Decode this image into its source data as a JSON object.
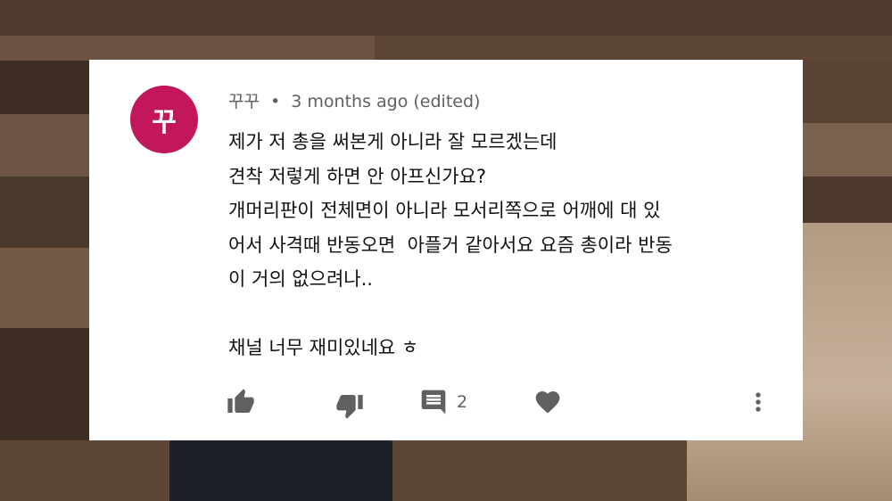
{
  "comment": {
    "avatar_initial": "꾸",
    "author": "꾸꾸",
    "separator": "•",
    "timestamp": "3 months ago (edited)",
    "lines": [
      "제가 저 총을 써본게 아니라 잘 모르겠는데",
      "견착 저렇게 하면 안 아프신가요?",
      "개머리판이 전체면이 아니라 모서리쪽으로 어깨에 대 있",
      "어서 사격때 반동오면  아플거 같아서요 요즘 총이라 반동",
      "이 거의 없으려나..",
      "",
      "채널 너무 재미있네요 ㅎ"
    ],
    "reply_count": "2"
  },
  "colors": {
    "avatar": "#c2185b",
    "icon": "#606060",
    "meta_text": "#606060"
  },
  "icons": [
    "thumbs-up-icon",
    "thumbs-down-icon",
    "comment-icon",
    "heart-icon",
    "more-vert-icon"
  ]
}
